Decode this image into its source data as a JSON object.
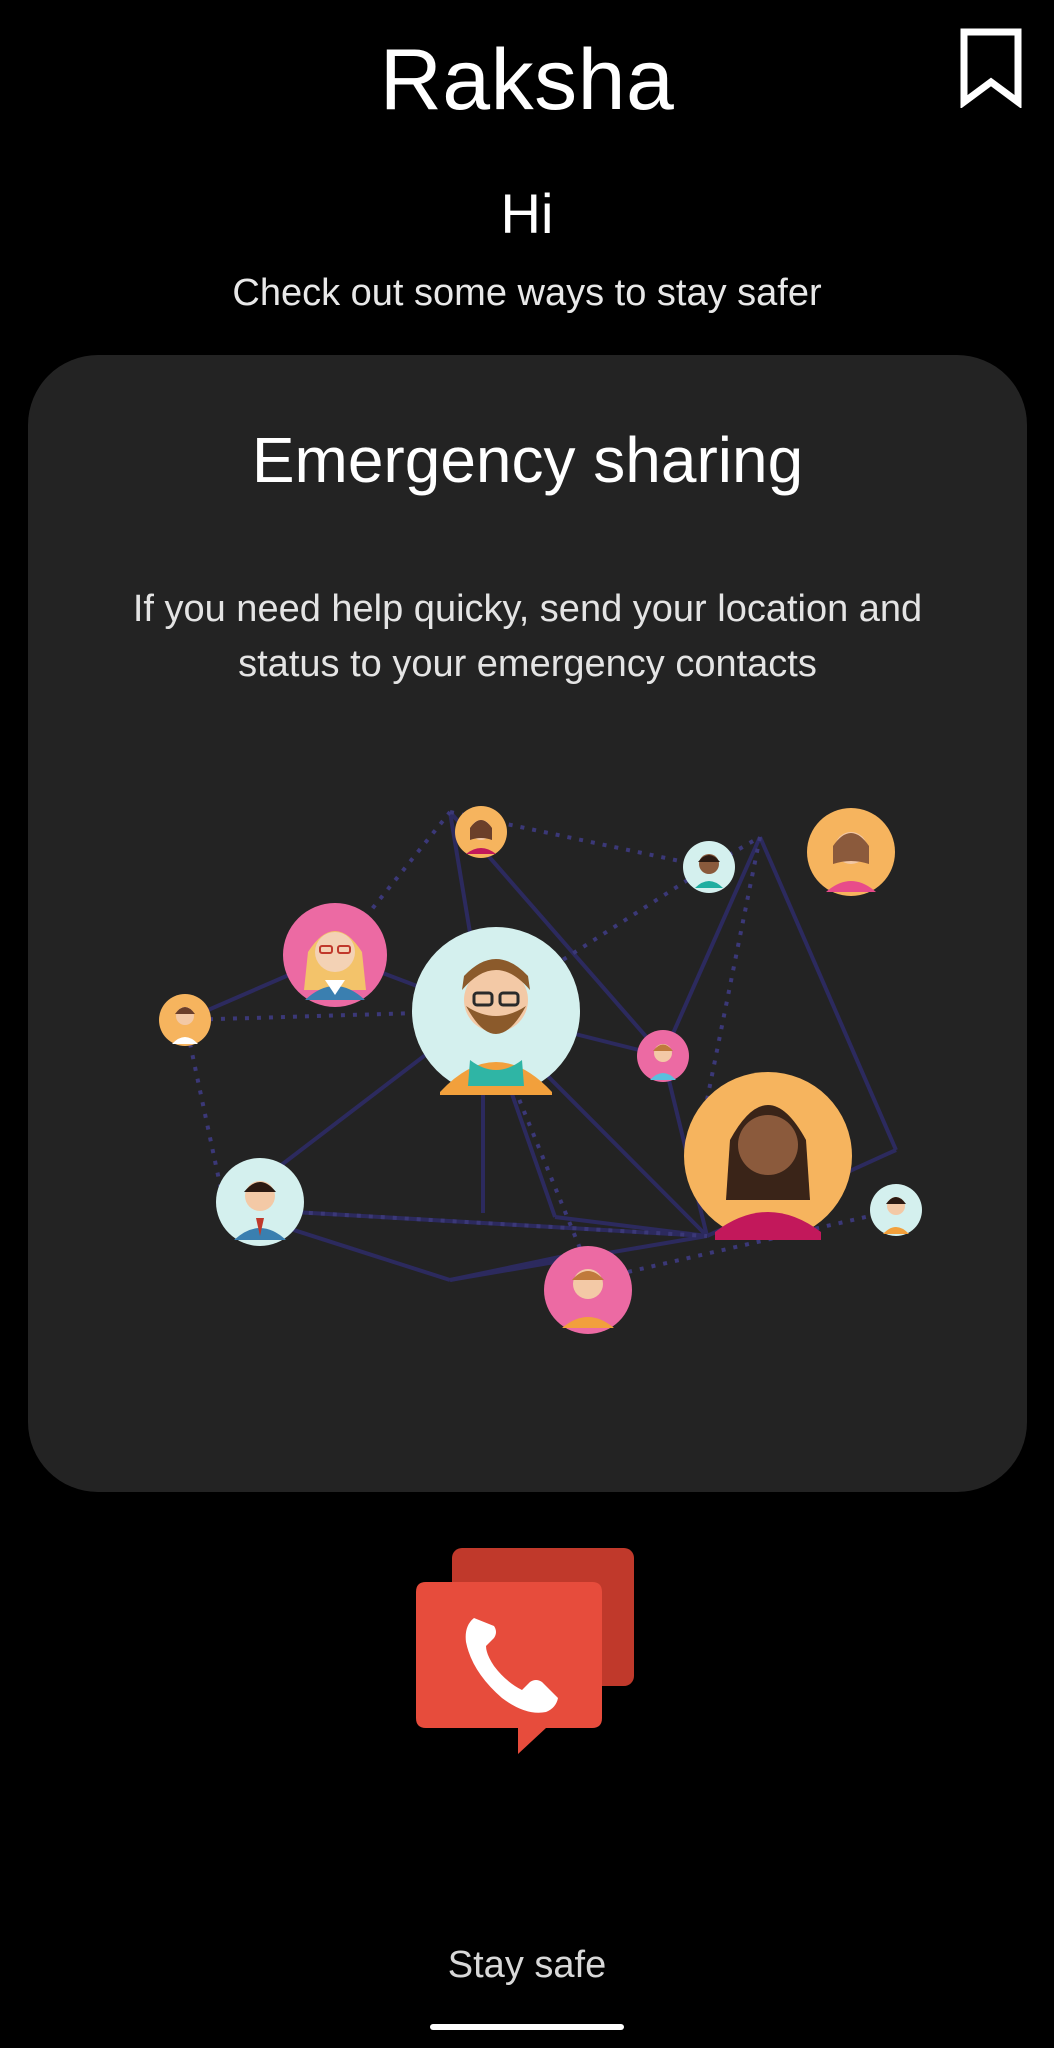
{
  "header": {
    "title": "Raksha",
    "bookmark_icon": "bookmark-icon"
  },
  "intro": {
    "greeting": "Hi",
    "subtitle": "Check out some ways to stay safer"
  },
  "card": {
    "title": "Emergency sharing",
    "description": "If you need help quicky, send your location and status to your emergency contacts",
    "illustration_icon": "contacts-network-illustration"
  },
  "action": {
    "icon": "emergency-call-chat-icon"
  },
  "footer": {
    "label": "Stay safe"
  },
  "colors": {
    "background": "#000000",
    "card": "#232323",
    "accent_red": "#e74c3c",
    "accent_red_dark": "#c0392b",
    "network_line": "#2c2a5e"
  }
}
